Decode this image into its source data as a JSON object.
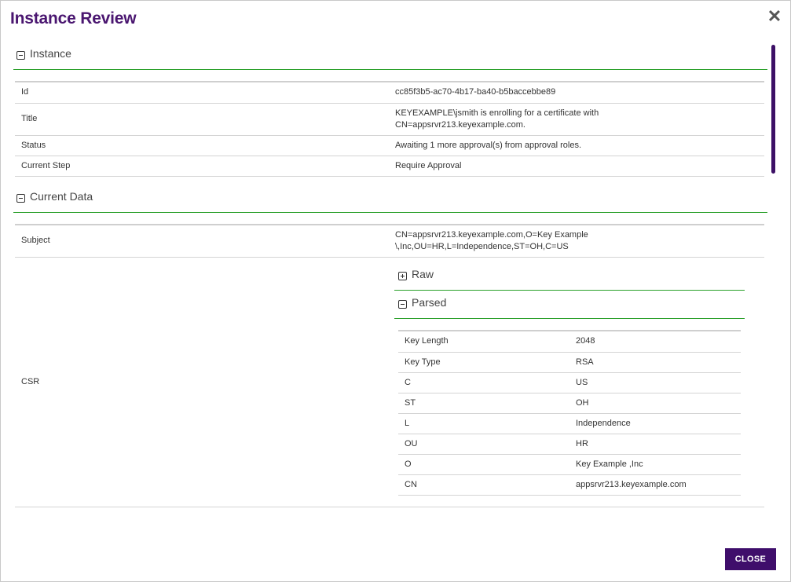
{
  "dialog": {
    "title": "Instance Review",
    "close_label": "CLOSE"
  },
  "instance": {
    "heading": "Instance",
    "rows": [
      {
        "label": "Id",
        "value": "cc85f3b5-ac70-4b17-ba40-b5baccebbe89"
      },
      {
        "label": "Title",
        "value_line1": "KEYEXAMPLE\\jsmith is enrolling for a certificate with",
        "value_line2": "CN=appsrvr213.keyexample.com."
      },
      {
        "label": "Status",
        "value": "Awaiting 1 more approval(s) from approval roles."
      },
      {
        "label": "Current Step",
        "value": "Require Approval"
      }
    ]
  },
  "current_data": {
    "heading": "Current Data",
    "subject": {
      "label": "Subject",
      "value_line1": "CN=appsrvr213.keyexample.com,O=Key Example",
      "value_line2": "\\,Inc,OU=HR,L=Independence,ST=OH,C=US"
    },
    "csr": {
      "label": "CSR",
      "raw_heading": "Raw",
      "parsed_heading": "Parsed",
      "parsed_rows": [
        {
          "key": "Key Length",
          "value": "2048"
        },
        {
          "key": "Key Type",
          "value": "RSA"
        },
        {
          "key": "C",
          "value": "US"
        },
        {
          "key": "ST",
          "value": "OH"
        },
        {
          "key": "L",
          "value": "Independence"
        },
        {
          "key": "OU",
          "value": "HR"
        },
        {
          "key": "O",
          "value": "Key Example ,Inc"
        },
        {
          "key": "CN",
          "value": "appsrvr213.keyexample.com"
        }
      ]
    }
  },
  "icons": {
    "close": "close-icon",
    "collapse": "minus-square-icon",
    "expand": "plus-square-icon"
  },
  "colors": {
    "title": "#4a1670",
    "accent_line": "#2aa02a",
    "button_bg": "#3f0e6b",
    "scrollbar": "#3d1066"
  }
}
